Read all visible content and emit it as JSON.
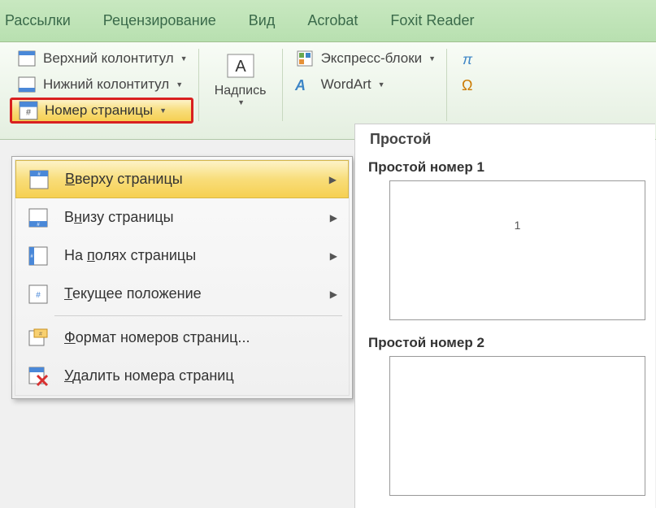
{
  "tabs": {
    "mailings": "Рассылки",
    "review": "Рецензирование",
    "view": "Вид",
    "acrobat": "Acrobat",
    "foxit": "Foxit Reader"
  },
  "ribbon": {
    "header_top": "Верхний колонтитул",
    "header_bottom": "Нижний колонтитул",
    "page_number": "Номер страницы",
    "text_box": "Надпись",
    "quick_parts": "Экспресс-блоки",
    "wordart": "WordArt"
  },
  "menu": {
    "top_of_page": "Вверху страницы",
    "bottom_of_page": "Внизу страницы",
    "page_margins": "На полях страницы",
    "current_position": "Текущее положение",
    "format": "Формат номеров страниц...",
    "remove": "Удалить номера страниц"
  },
  "gallery": {
    "category": "Простой",
    "item1_title": "Простой номер 1",
    "item1_value": "1",
    "item2_title": "Простой номер 2"
  },
  "underline": {
    "top": "В",
    "bottom": "н",
    "margins": "п",
    "current": "Т",
    "format": "Ф",
    "remove": "У"
  }
}
